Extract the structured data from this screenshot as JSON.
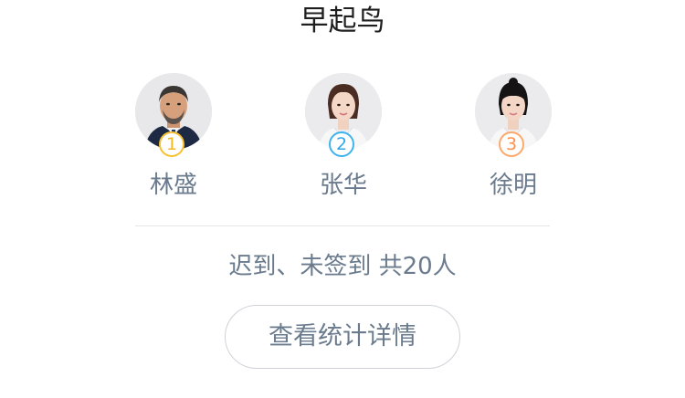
{
  "header": {
    "title": "早起鸟"
  },
  "ranking": [
    {
      "rank": "1",
      "name": "林盛",
      "badge_color": "#f7c12f",
      "avatar": "man-portrait"
    },
    {
      "rank": "2",
      "name": "张华",
      "badge_color": "#3fb3ee",
      "avatar": "woman-portrait"
    },
    {
      "rank": "3",
      "name": "徐明",
      "badge_color": "#ffa86b",
      "avatar": "woman-portrait"
    }
  ],
  "summary": {
    "text": "迟到、未签到 共20人"
  },
  "actions": {
    "view_stats_label": "查看统计详情"
  }
}
